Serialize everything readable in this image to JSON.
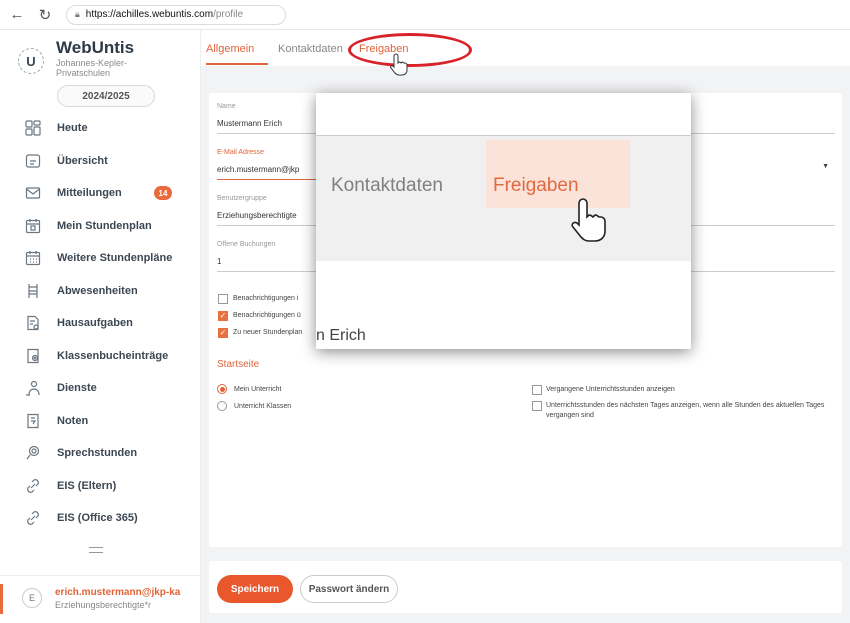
{
  "browser": {
    "url_host": "https://achilles.webuntis.com",
    "url_path": "/profile"
  },
  "brand": {
    "title": "WebUntis",
    "subtitle1": "Johannes-Kepler-",
    "subtitle2": "Privatschulen",
    "logo_letter": "U"
  },
  "school_year": "2024/2025",
  "sidebar": {
    "items": [
      {
        "label": "Heute",
        "icon": "grid-icon"
      },
      {
        "label": "Übersicht",
        "icon": "overview-icon"
      },
      {
        "label": "Mitteilungen",
        "icon": "mail-icon",
        "badge": "14"
      },
      {
        "label": "Mein Stundenplan",
        "icon": "calendar-icon"
      },
      {
        "label": "Weitere Stundenpläne",
        "icon": "calendar-grid-icon"
      },
      {
        "label": "Abwesenheiten",
        "icon": "chair-icon"
      },
      {
        "label": "Hausaufgaben",
        "icon": "homework-icon"
      },
      {
        "label": "Klassenbucheinträge",
        "icon": "classbook-icon"
      },
      {
        "label": "Dienste",
        "icon": "duty-icon"
      },
      {
        "label": "Noten",
        "icon": "grades-icon"
      },
      {
        "label": "Sprechstunden",
        "icon": "consultation-icon"
      },
      {
        "label": "EIS (Eltern)",
        "icon": "link-icon"
      },
      {
        "label": "EIS (Office 365)",
        "icon": "link-icon"
      }
    ]
  },
  "user": {
    "avatar": "E",
    "email": "erich.mustermann@jkp-ka",
    "role": "Erziehungsberechtigte*r"
  },
  "tabs": [
    "Allgemein",
    "Kontaktdaten",
    "Freigaben"
  ],
  "form": {
    "name_label": "Name",
    "name_value": "Mustermann Erich",
    "email_label": "E-Mail Adresse",
    "email_value": "erich.mustermann@jkp",
    "group_label": "Benutzergruppe",
    "group_value": "Erziehungsberechtigte",
    "bookings_label": "Offene Buchungen",
    "bookings_value": "1",
    "checks": [
      {
        "label": "Benachrichtigungen i",
        "checked": false
      },
      {
        "label": "Benachrichtigungen ü",
        "checked": true
      },
      {
        "label": "Zu neuer Stundenplan",
        "checked": true
      }
    ],
    "start_title": "Startseite",
    "radios": [
      {
        "label": "Mein Unterricht",
        "selected": true
      },
      {
        "label": "Unterricht Klassen",
        "selected": false
      }
    ],
    "right_checks": [
      {
        "label": "Vergangene Unterrichtsstunden anzeigen"
      },
      {
        "label": "Unterrichtsstunden des nächsten Tages anzeigen, wenn alle Stunden des aktuellen Tages vergangen sind"
      }
    ]
  },
  "zoom": {
    "tab1": "Kontaktdaten",
    "tab2": "Freigaben",
    "name_fragment": "n Erich"
  },
  "buttons": {
    "save": "Speichern",
    "change_password": "Passwort ändern"
  },
  "colors": {
    "accent": "#e0643a",
    "highlight": "#d9232a"
  }
}
